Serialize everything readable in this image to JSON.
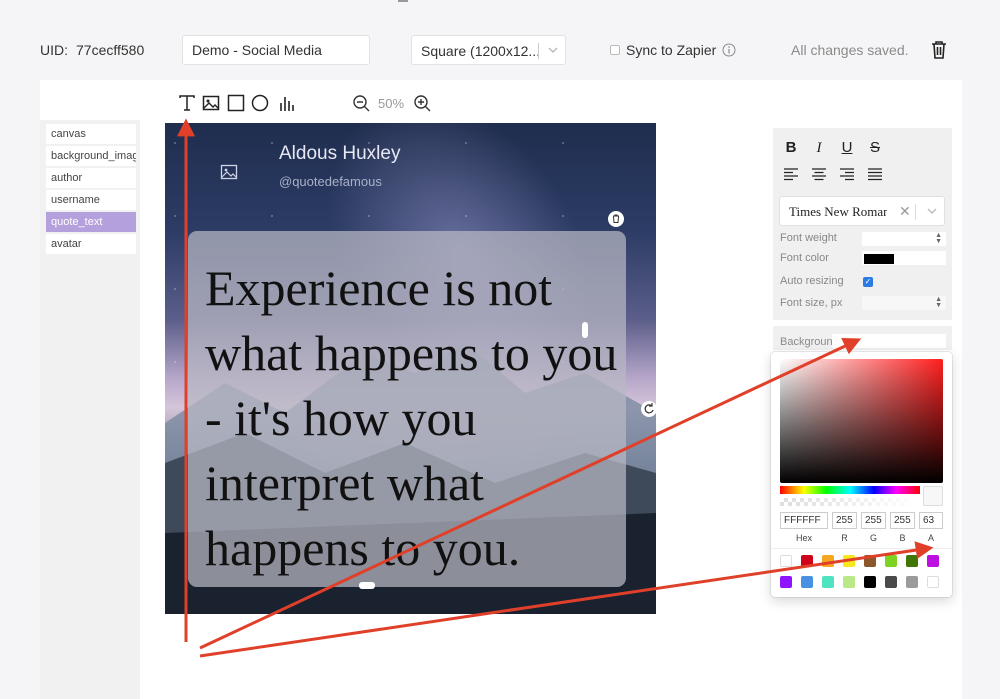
{
  "header": {
    "uid_label": "UID:",
    "uid_value": "77cecff580",
    "project_name": "Demo - Social Media",
    "size_select": "Square (1200x12...",
    "sync_label": "Sync to Zapier",
    "save_status": "All changes saved."
  },
  "toolbar": {
    "tools": [
      "text-tool-icon",
      "image-tool-icon",
      "rectangle-tool-icon",
      "circle-tool-icon",
      "chart-tool-icon"
    ],
    "zoom": "50%"
  },
  "layers": {
    "items": [
      "canvas",
      "background_image",
      "author",
      "username",
      "quote_text",
      "avatar"
    ],
    "active": "quote_text"
  },
  "canvas": {
    "author": "Aldous Huxley",
    "username": "@quotedefamous",
    "quote": "Experience is not what happens to you - it's how you interpret what happens to you."
  },
  "properties": {
    "format_buttons": [
      "B",
      "I",
      "U",
      "S"
    ],
    "align_buttons": [
      "align-left-icon",
      "align-center-icon",
      "align-right-icon",
      "align-justify-icon"
    ],
    "font_family": "Times New Roman",
    "font_weight_label": "Font weight",
    "font_color_label": "Font color",
    "auto_resizing_label": "Auto resizing",
    "auto_resizing_checked": true,
    "font_size_label": "Font size, px",
    "background_label": "Background",
    "font_color_value": "#000000"
  },
  "color_picker": {
    "hex": "FFFFFF",
    "r": "255",
    "g": "255",
    "b": "255",
    "a": "63",
    "labels": [
      "Hex",
      "R",
      "G",
      "B",
      "A"
    ],
    "swatches": [
      "#ffffff",
      "#d0021b",
      "#f5a623",
      "#f8e71c",
      "#8b572a",
      "#7ed321",
      "#417505",
      "#bd10e0",
      "#9013fe",
      "#4a90e2",
      "#50e3c2",
      "#b8e986",
      "#000000",
      "#4a4a4a",
      "#9b9b9b",
      "#ffffff"
    ]
  },
  "colors": {
    "accent_layer": "#b4a0dc",
    "annotation_arrow": "#e0402a",
    "checkbox": "#2c7be5"
  }
}
